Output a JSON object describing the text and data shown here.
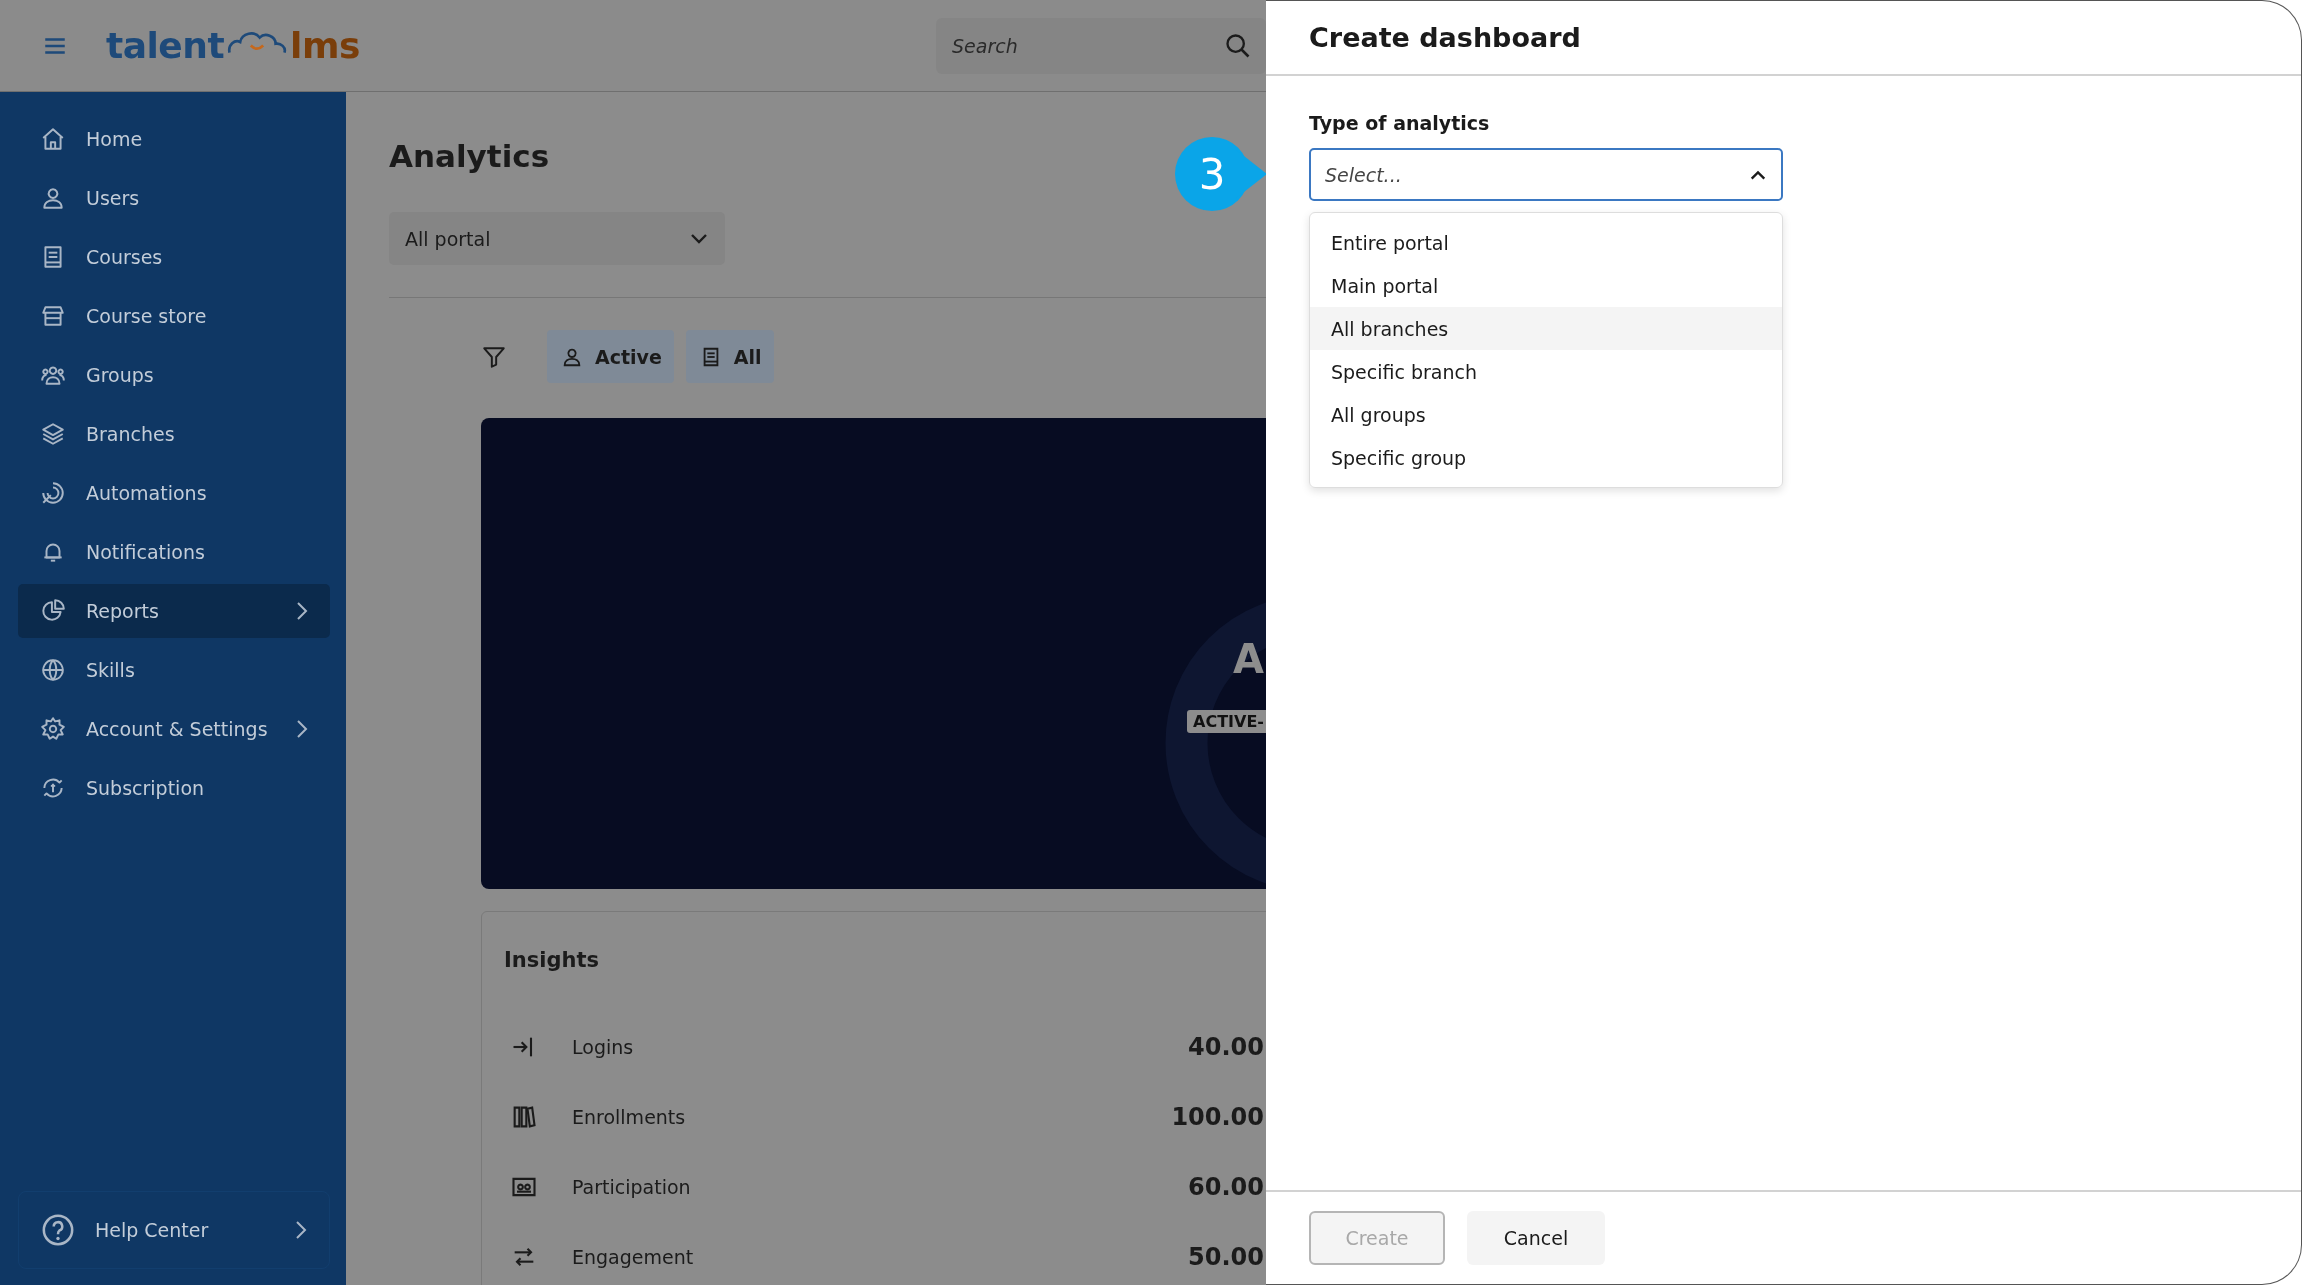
{
  "header": {
    "logo_left": "talent",
    "logo_right": "lms",
    "search": {
      "placeholder": "Search"
    }
  },
  "sidebar": {
    "items": [
      {
        "label": "Home",
        "selected": false,
        "expandable": false
      },
      {
        "label": "Users",
        "selected": false,
        "expandable": false
      },
      {
        "label": "Courses",
        "selected": false,
        "expandable": false
      },
      {
        "label": "Course store",
        "selected": false,
        "expandable": false
      },
      {
        "label": "Groups",
        "selected": false,
        "expandable": false
      },
      {
        "label": "Branches",
        "selected": false,
        "expandable": false
      },
      {
        "label": "Automations",
        "selected": false,
        "expandable": false
      },
      {
        "label": "Notifications",
        "selected": false,
        "expandable": false
      },
      {
        "label": "Reports",
        "selected": true,
        "expandable": true
      },
      {
        "label": "Skills",
        "selected": false,
        "expandable": false
      },
      {
        "label": "Account & Settings",
        "selected": false,
        "expandable": true
      },
      {
        "label": "Subscription",
        "selected": false,
        "expandable": false
      }
    ],
    "help": {
      "label": "Help Center"
    }
  },
  "main": {
    "title": "Analytics",
    "scope_select": {
      "value": "All portal"
    },
    "filters": [
      {
        "label": "Active"
      },
      {
        "label": "All"
      }
    ],
    "banner": {
      "heading": "A",
      "tag": "ACTIVE-"
    },
    "insights": {
      "title": "Insights",
      "rows": [
        {
          "label": "Logins",
          "value": "40.00"
        },
        {
          "label": "Enrollments",
          "value": "100.00"
        },
        {
          "label": "Participation",
          "value": "60.00"
        },
        {
          "label": "Engagement",
          "value": "50.00"
        }
      ]
    }
  },
  "callout": {
    "number": "3"
  },
  "panel": {
    "title": "Create dashboard",
    "field": {
      "label": "Type of analytics",
      "placeholder": "Select...",
      "expanded": true,
      "options": [
        {
          "label": "Entire portal",
          "highlighted": false
        },
        {
          "label": "Main portal",
          "highlighted": false
        },
        {
          "label": "All branches",
          "highlighted": true
        },
        {
          "label": "Specific branch",
          "highlighted": false
        },
        {
          "label": "All groups",
          "highlighted": false
        },
        {
          "label": "Specific group",
          "highlighted": false
        }
      ]
    },
    "buttons": [
      {
        "label": "Create",
        "disabled": true
      },
      {
        "label": "Cancel",
        "disabled": false
      }
    ]
  }
}
